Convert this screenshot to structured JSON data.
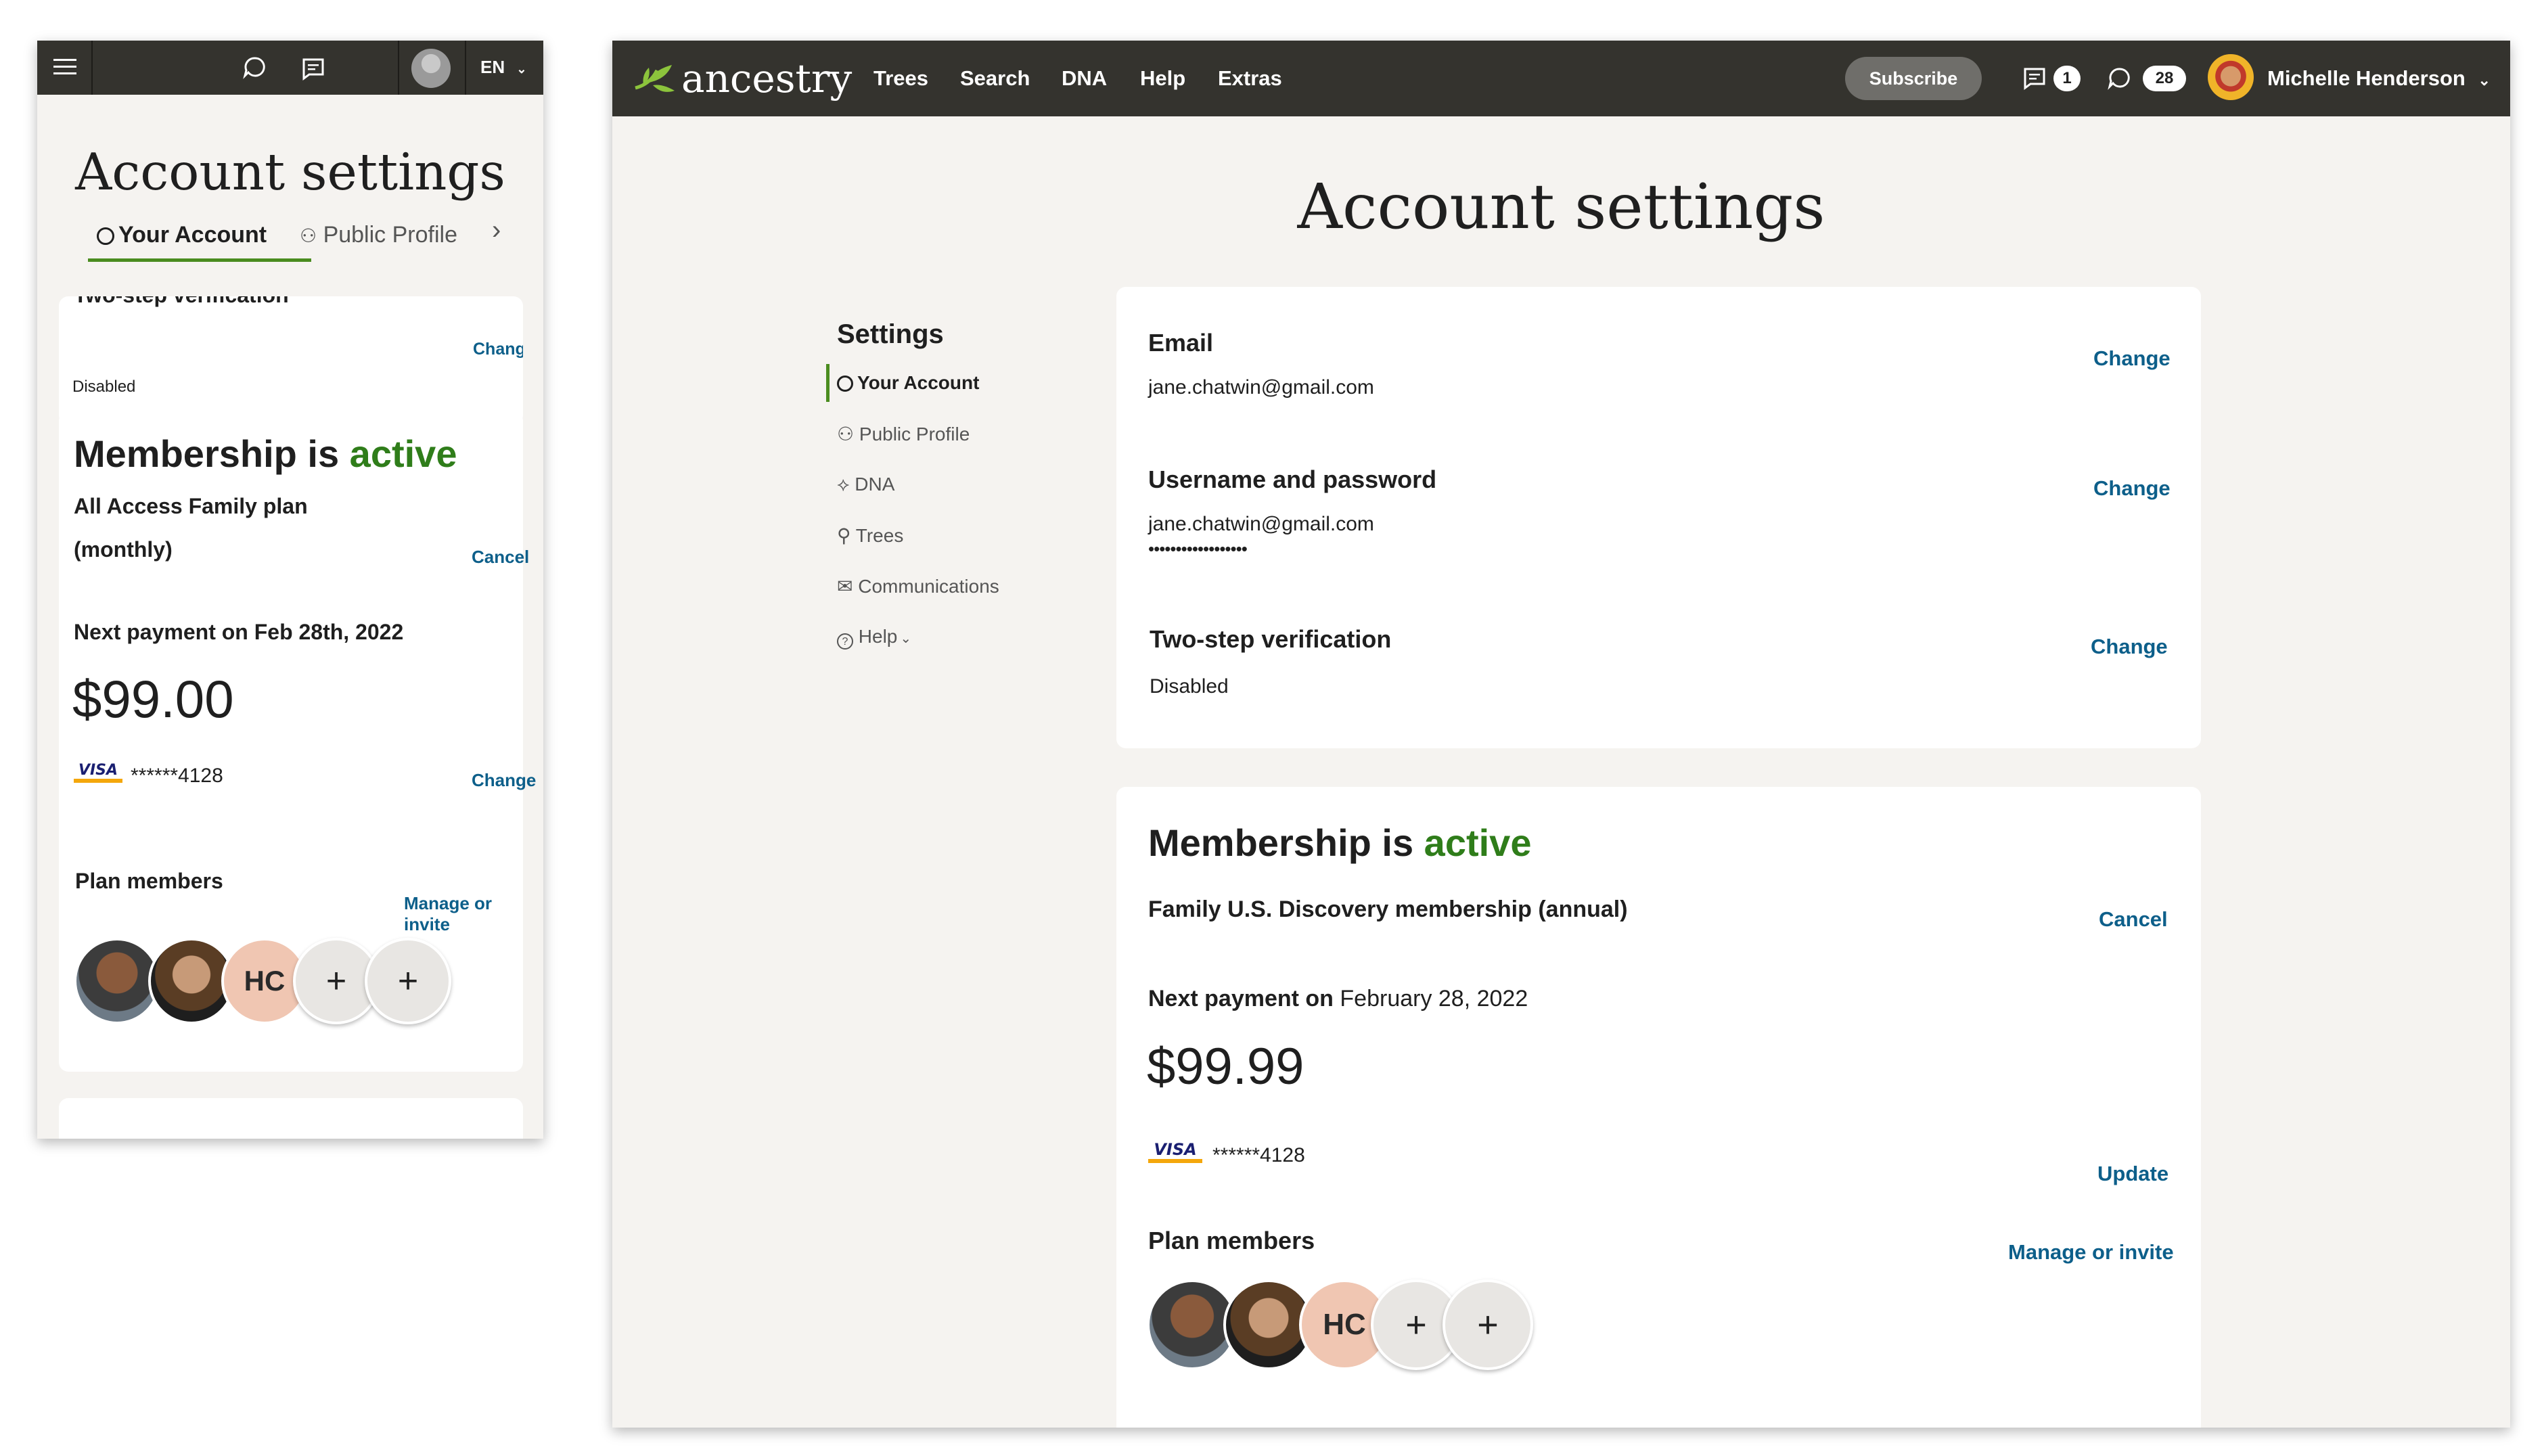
{
  "mobile": {
    "topbar": {
      "menu_icon": "hamburger-menu-icon",
      "lang": "EN"
    },
    "title": "Account settings",
    "tabs": [
      {
        "label": "Your Account",
        "active": true
      },
      {
        "label": "Public Profile",
        "active": false
      }
    ],
    "two_step": {
      "label": "Two-step verification",
      "status": "Disabled",
      "action": "Change"
    },
    "membership": {
      "heading_prefix": "Membership is",
      "heading_status": "active",
      "plan_line1": "All Access Family plan",
      "plan_line2": "(monthly)",
      "cancel": "Cancel",
      "next_payment": "Next payment on Feb 28th, 2022",
      "amount": "$99.00",
      "card_brand": "VISA",
      "card_number": "******4128",
      "card_action": "Change",
      "members_label": "Plan members",
      "members_action": "Manage or invite",
      "initials": "HC"
    }
  },
  "desktop": {
    "brand": "ancestry",
    "nav": [
      "Trees",
      "Search",
      "DNA",
      "Help",
      "Extras"
    ],
    "subscribe": "Subscribe",
    "messages_count": "1",
    "notifications_count": "28",
    "user_name": "Michelle Henderson",
    "title": "Account settings",
    "sidebar": {
      "heading": "Settings",
      "items": [
        "Your Account",
        "Public Profile",
        "DNA",
        "Trees",
        "Communications",
        "Help"
      ]
    },
    "account": {
      "email_label": "Email",
      "email_value": "jane.chatwin@gmail.com",
      "email_action": "Change",
      "userpass_label": "Username and password",
      "userpass_value": "jane.chatwin@gmail.com",
      "password_mask": "••••••••••••••••••",
      "userpass_action": "Change",
      "twostep_label": "Two-step verification",
      "twostep_value": "Disabled",
      "twostep_action": "Change"
    },
    "membership": {
      "heading_prefix": "Membership is",
      "heading_status": "active",
      "plan": "Family U.S. Discovery membership (annual)",
      "cancel": "Cancel",
      "next_payment_label": "Next payment on",
      "next_payment_date": "February 28, 2022",
      "amount": "$99.99",
      "card_brand": "VISA",
      "card_number": "******4128",
      "card_action": "Update",
      "members_label": "Plan members",
      "members_action": "Manage or invite",
      "initials": "HC"
    }
  },
  "colors": {
    "topbar": "#34332e",
    "background": "#f5f3f0",
    "link": "#0d5f8a",
    "active_green": "#2f7d1a",
    "tab_underline": "#4a8c1f"
  }
}
